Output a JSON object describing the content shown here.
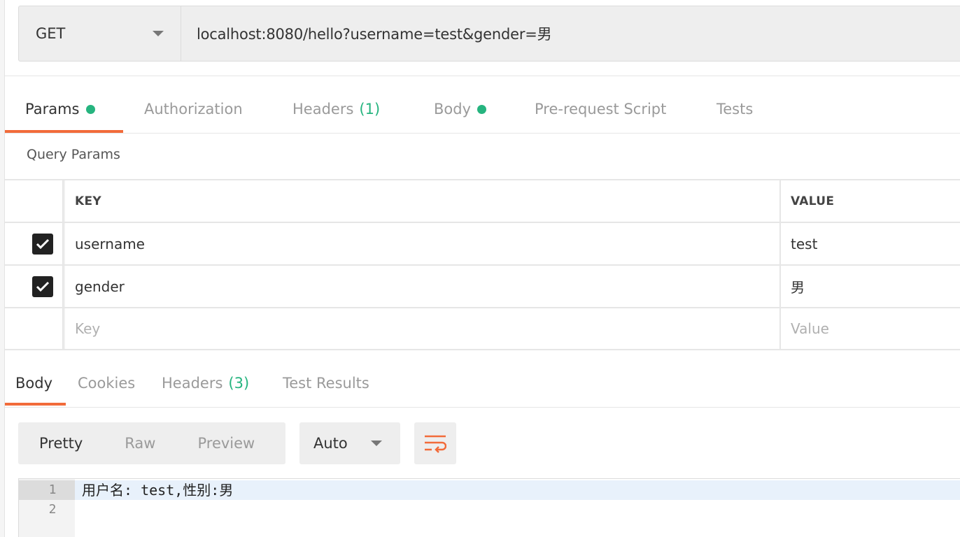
{
  "request": {
    "method": "GET",
    "url": "localhost:8080/hello?username=test&gender=男"
  },
  "request_tabs": [
    {
      "label": "Params",
      "dot": true,
      "active": true
    },
    {
      "label": "Authorization"
    },
    {
      "label": "Headers",
      "count": "(1)"
    },
    {
      "label": "Body",
      "dot": true
    },
    {
      "label": "Pre-request Script"
    },
    {
      "label": "Tests"
    }
  ],
  "query_params": {
    "title": "Query Params",
    "headers": {
      "key": "KEY",
      "value": "VALUE"
    },
    "rows": [
      {
        "checked": true,
        "key": "username",
        "value": "test"
      },
      {
        "checked": true,
        "key": "gender",
        "value": "男"
      }
    ],
    "placeholder": {
      "key": "Key",
      "value": "Value"
    }
  },
  "response_tabs": [
    {
      "label": "Body",
      "active": true
    },
    {
      "label": "Cookies"
    },
    {
      "label": "Headers",
      "count": "(3)"
    },
    {
      "label": "Test Results"
    }
  ],
  "response_toolbar": {
    "views": [
      "Pretty",
      "Raw",
      "Preview"
    ],
    "selected_view": "Pretty",
    "format": "Auto"
  },
  "response_body": {
    "lines": [
      {
        "number": "1",
        "text": "用户名: test,性别:男"
      },
      {
        "number": "2",
        "text": ""
      }
    ]
  },
  "colors": {
    "accent": "#f26b3a",
    "status_green": "#26b47f"
  }
}
